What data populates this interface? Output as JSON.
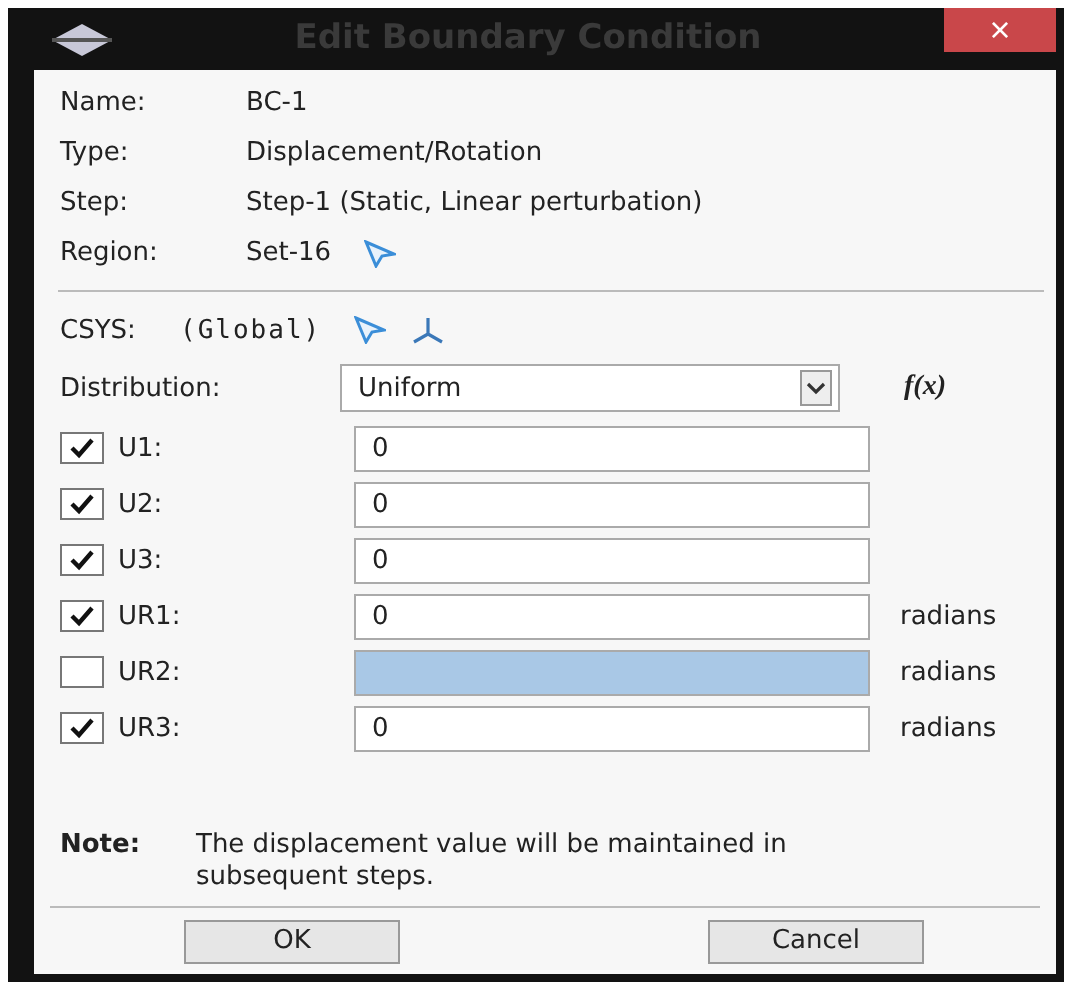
{
  "window": {
    "title": "Edit Boundary Condition",
    "close": "×"
  },
  "info": [
    {
      "label": "Name:",
      "value": "BC-1"
    },
    {
      "label": "Type:",
      "value": "Displacement/Rotation"
    },
    {
      "label": "Step:",
      "value": "Step-1 (Static, Linear perturbation)"
    },
    {
      "label": "Region:",
      "value": "Set-16",
      "kind": "pick"
    }
  ],
  "csys": {
    "label": "CSYS:",
    "value": "(Global)"
  },
  "distribution": {
    "label": "Distribution:",
    "value": "Uniform",
    "function": "f(x)"
  },
  "dofs": [
    {
      "label": "U1:",
      "checked": true,
      "value": "0"
    },
    {
      "label": "U2:",
      "checked": true,
      "value": "0"
    },
    {
      "label": "U3:",
      "checked": true,
      "value": "0"
    },
    {
      "label": "UR1:",
      "checked": true,
      "value": "0",
      "unit": "radians"
    },
    {
      "label": "UR2:",
      "checked": false,
      "unit": "radians"
    },
    {
      "label": "UR3:",
      "checked": true,
      "value": "0",
      "unit": "radians"
    }
  ],
  "note": {
    "label": "Note:",
    "text": "The displacement value will be maintained in subsequent steps."
  },
  "buttons": [
    "OK",
    "Cancel"
  ]
}
